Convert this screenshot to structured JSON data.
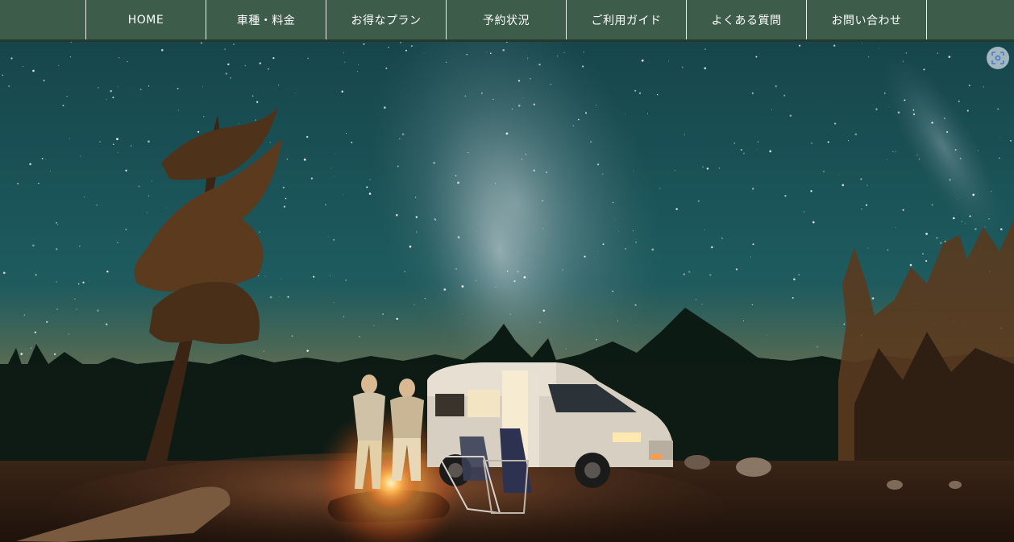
{
  "nav": {
    "items": [
      {
        "label": "HOME"
      },
      {
        "label": "車種・料金"
      },
      {
        "label": "お得なプラン"
      },
      {
        "label": "予約状況"
      },
      {
        "label": "ご利用ガイド"
      },
      {
        "label": "よくある質問"
      },
      {
        "label": "お問い合わせ"
      }
    ]
  },
  "hero": {
    "image_icon": "camper-van-campfire-milky-way-photo"
  },
  "lens_button": {
    "icon": "lens-search-icon"
  },
  "colors": {
    "nav_bg": "#3d5c49",
    "nav_border": "#24382b",
    "nav_text": "#ffffff"
  }
}
